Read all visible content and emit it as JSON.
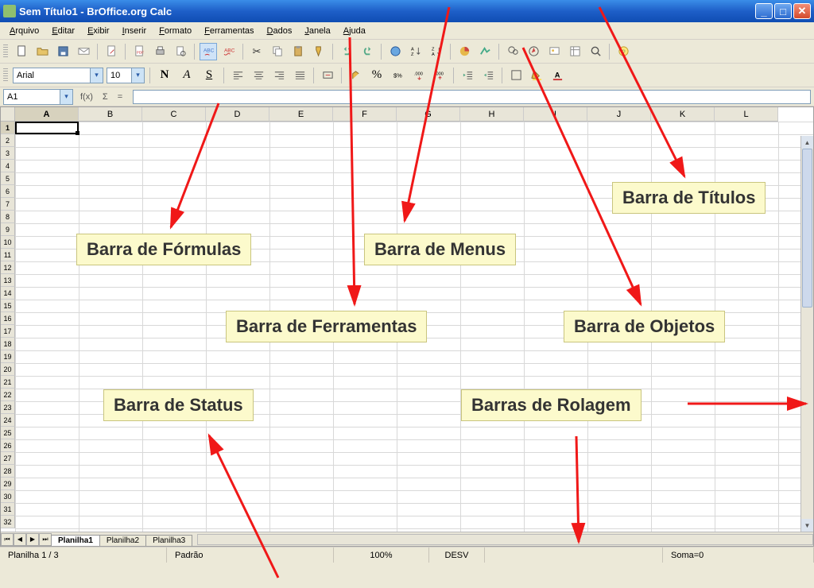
{
  "title": "Sem Título1 - BrOffice.org Calc",
  "menus": [
    "Arquivo",
    "Editar",
    "Exibir",
    "Inserir",
    "Formato",
    "Ferramentas",
    "Dados",
    "Janela",
    "Ajuda"
  ],
  "format": {
    "font_name": "Arial",
    "font_size": "10"
  },
  "namebox": "A1",
  "fx_label": "f(x)",
  "sigma_label": "Σ",
  "eq_label": "=",
  "columns": [
    "A",
    "B",
    "C",
    "D",
    "E",
    "F",
    "G",
    "H",
    "I",
    "J",
    "K",
    "L"
  ],
  "row_count": 32,
  "sheet_tabs": [
    "Planilha1",
    "Planilha2",
    "Planilha3"
  ],
  "active_sheet": 0,
  "status": {
    "sheet": "Planilha 1 / 3",
    "style": "Padrão",
    "zoom": "100%",
    "mode": "DESV",
    "sum": "Soma=0"
  },
  "annotations": {
    "formulas": "Barra de Fórmulas",
    "menus": "Barra de Menus",
    "titles": "Barra de Títulos",
    "tools": "Barra de Ferramentas",
    "objects": "Barra de Objetos",
    "status": "Barra de Status",
    "scroll": "Barras de Rolagem"
  }
}
